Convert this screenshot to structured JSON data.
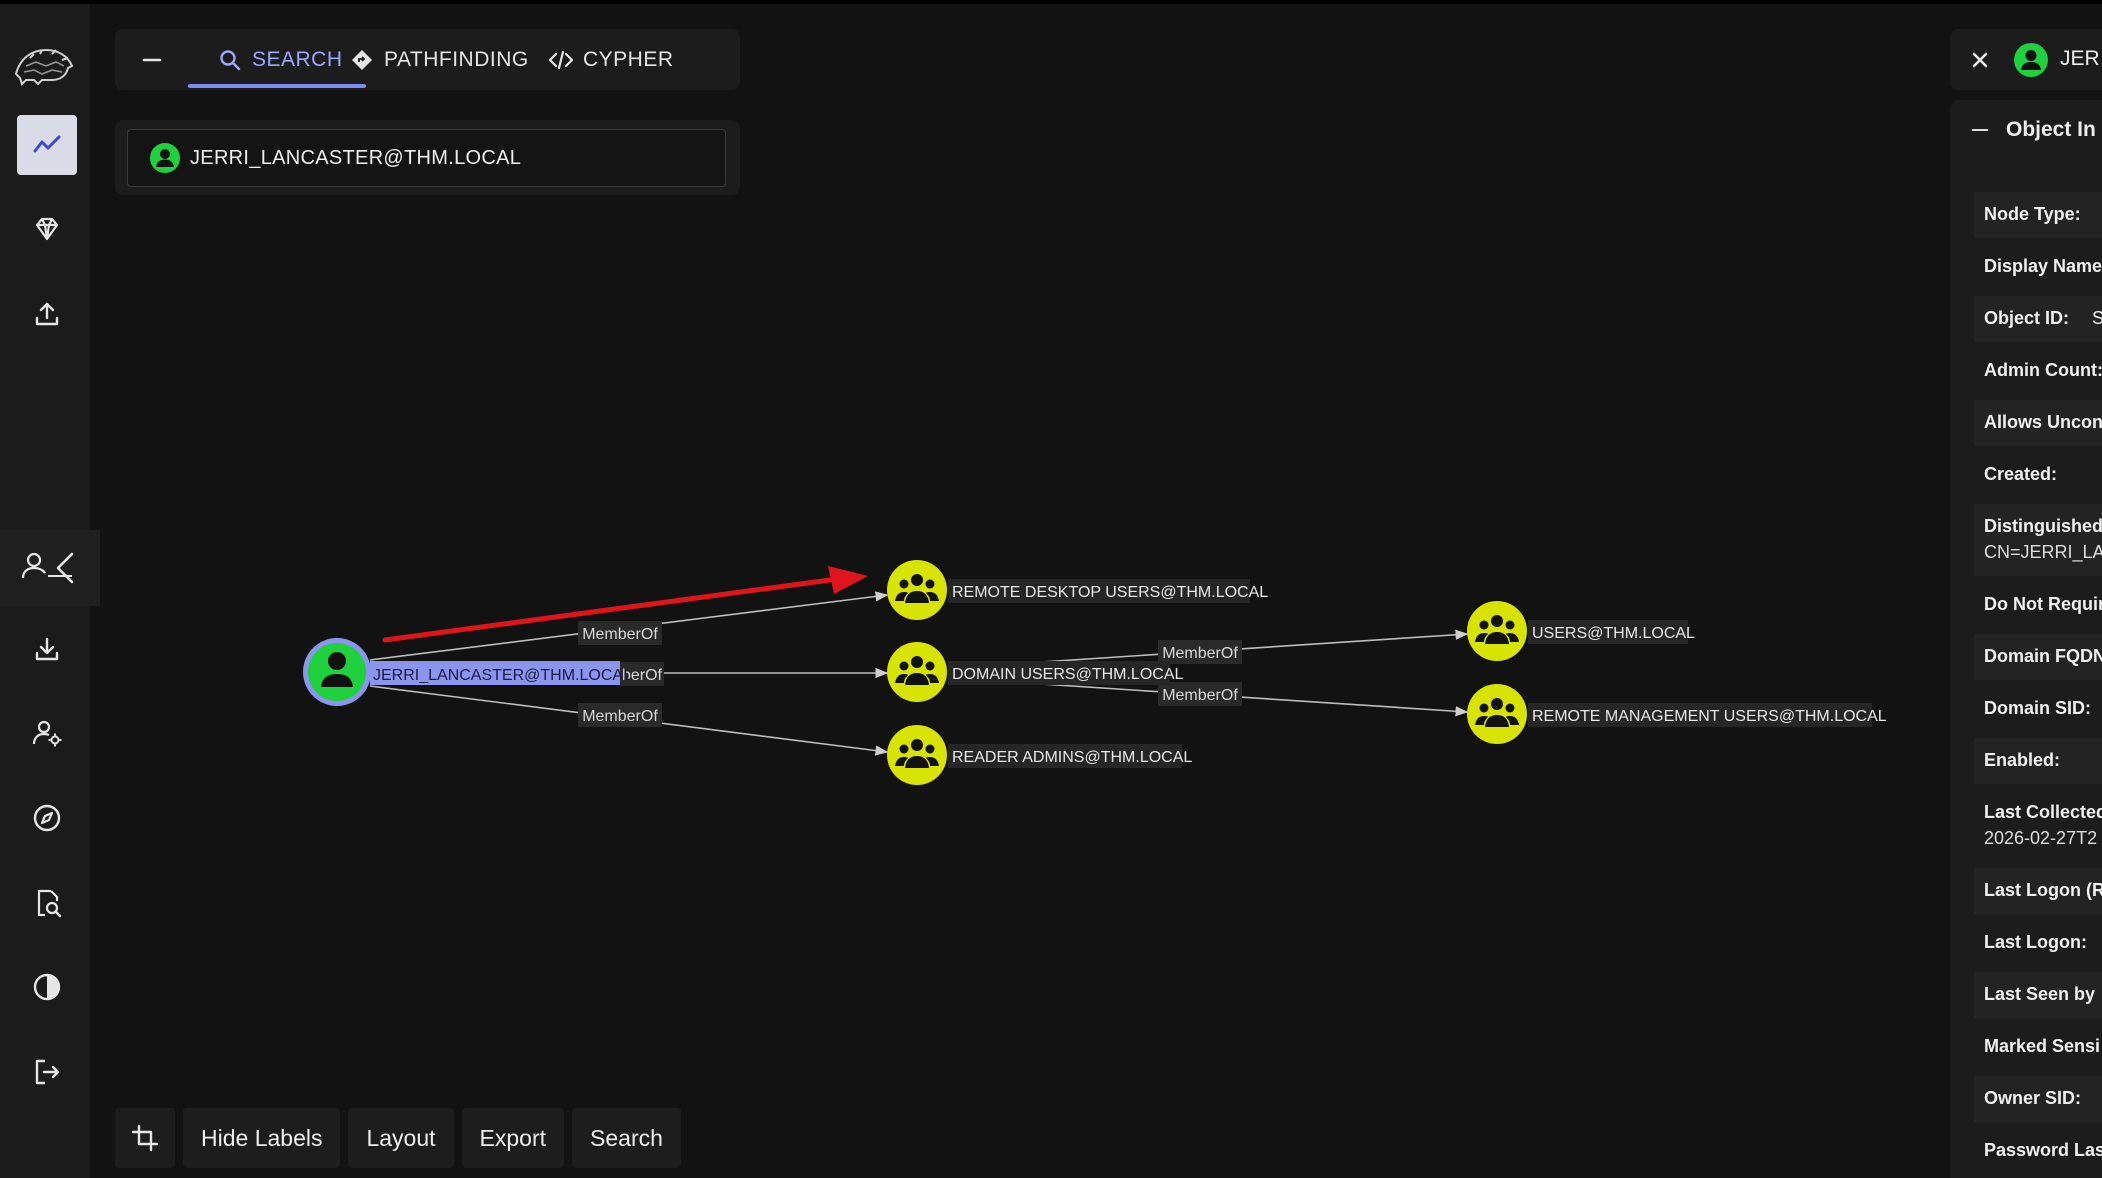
{
  "tabs": [
    {
      "label": "SEARCH",
      "icon": "search-icon"
    },
    {
      "label": "PATHFINDING",
      "icon": "diamond-icon"
    },
    {
      "label": "CYPHER",
      "icon": "code-icon"
    }
  ],
  "search": {
    "value": "JERRI_LANCASTER@THM.LOCAL"
  },
  "graph": {
    "nodes": {
      "user": "JERRI_LANCASTER@THM.LOCAL",
      "rdu": "REMOTE DESKTOP USERS@THM.LOCAL",
      "du": "DOMAIN USERS@THM.LOCAL",
      "ra": "READER ADMINS@THM.LOCAL",
      "users": "USERS@THM.LOCAL",
      "rmu": "REMOTE MANAGEMENT USERS@THM.LOCAL"
    },
    "edges": {
      "e1": "MemberOf",
      "e2": "berOf",
      "e3": "MemberOf",
      "e4": "MemberOf",
      "e5": "MemberOf"
    },
    "colors": {
      "user_node": "#1fd13c",
      "group_node": "#d7e300",
      "highlight_arrow": "#e0141b",
      "selected_label": "#8b95ee"
    }
  },
  "toolbar": {
    "hide_labels": "Hide Labels",
    "layout": "Layout",
    "export": "Export",
    "search": "Search"
  },
  "panel": {
    "header_name": "JER",
    "section_title": "Object In",
    "rows": [
      {
        "label": "Node Type:"
      },
      {
        "label": "Display Name"
      },
      {
        "label": "Object ID:",
        "value_stub": "S"
      },
      {
        "label": "Admin Count:"
      },
      {
        "label": "Allows Uncon"
      },
      {
        "label": "Created:"
      },
      {
        "label": "Distinguished",
        "value": "CN=JERRI_LA"
      },
      {
        "label": "Do Not Requir"
      },
      {
        "label": "Domain FQDN"
      },
      {
        "label": "Domain SID:"
      },
      {
        "label": "Enabled:"
      },
      {
        "label": "Last Collected",
        "value": "2026-02-27T2"
      },
      {
        "label": "Last Logon (R"
      },
      {
        "label": "Last Logon:"
      },
      {
        "label": "Last Seen by"
      },
      {
        "label": "Marked Sensi"
      },
      {
        "label": "Owner SID:"
      },
      {
        "label": "Password Las"
      }
    ]
  }
}
